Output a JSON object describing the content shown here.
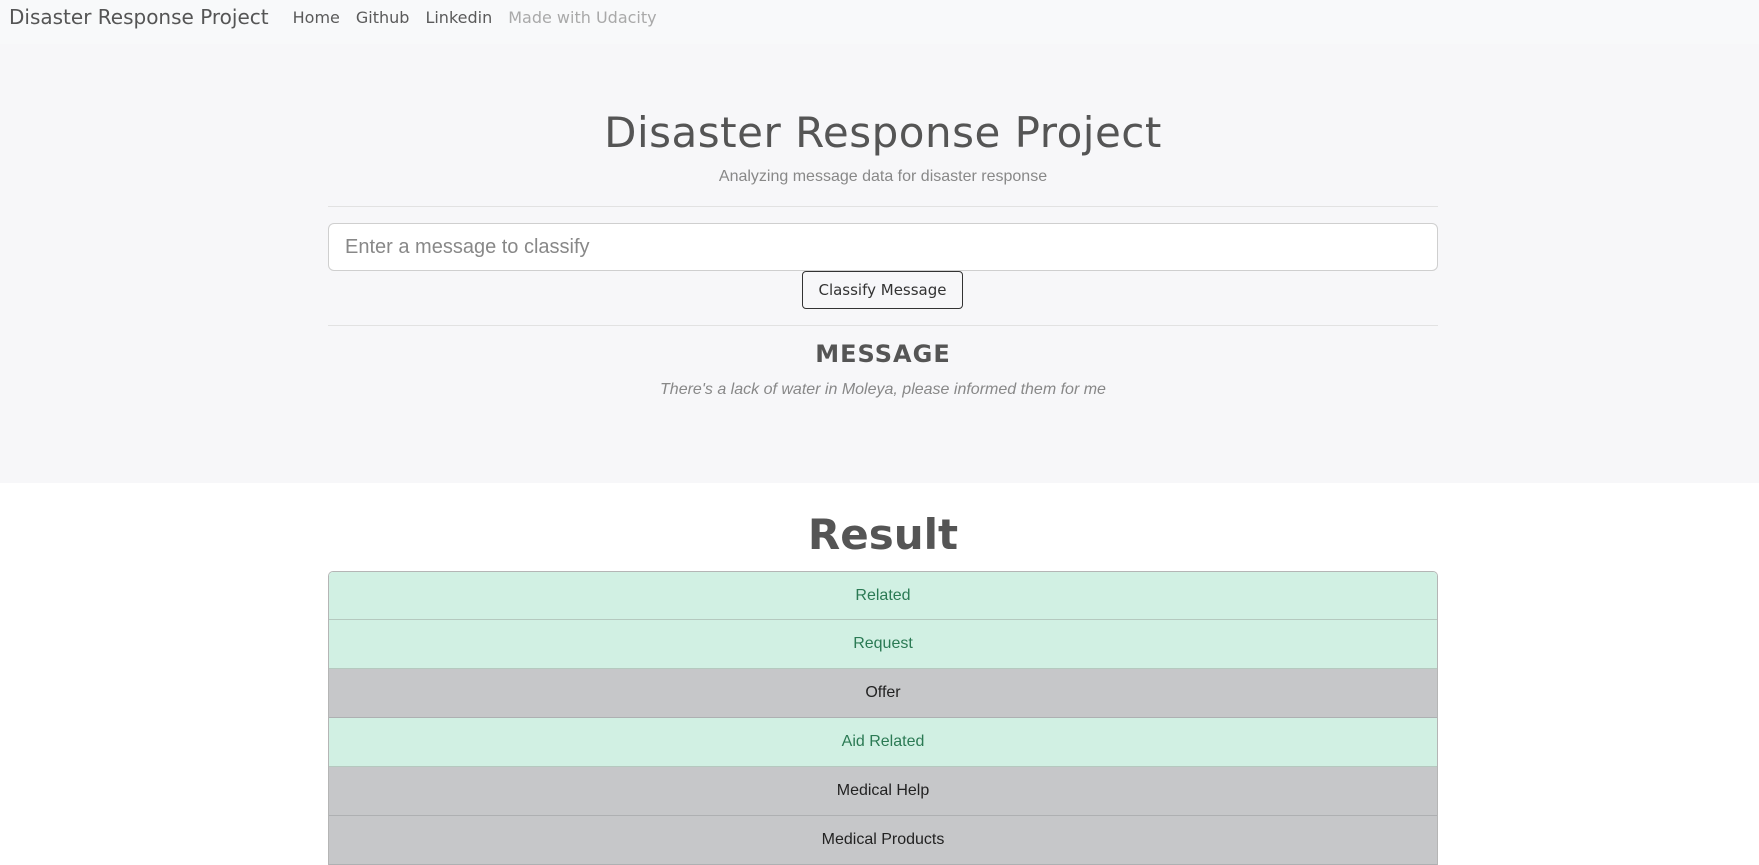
{
  "navbar": {
    "brand": "Disaster Response Project",
    "links": [
      "Home",
      "Github",
      "Linkedin"
    ],
    "muted_link": "Made with Udacity"
  },
  "header": {
    "title": "Disaster Response Project",
    "subtitle": "Analyzing message data for disaster response",
    "input_placeholder": "Enter a message to classify",
    "button_label": "Classify Message",
    "message_heading": "MESSAGE",
    "message_text": "There's a lack of water in Moleya, please informed them for me"
  },
  "result": {
    "title": "Result",
    "categories": [
      {
        "label": "Related",
        "active": true
      },
      {
        "label": "Request",
        "active": true
      },
      {
        "label": "Offer",
        "active": false
      },
      {
        "label": "Aid Related",
        "active": true
      },
      {
        "label": "Medical Help",
        "active": false
      },
      {
        "label": "Medical Products",
        "active": false
      }
    ]
  },
  "colors": {
    "active_bg": "#d1f0e3",
    "active_text": "#2b7a54",
    "inactive_bg": "#c6c7c9",
    "inactive_text": "#222222"
  }
}
